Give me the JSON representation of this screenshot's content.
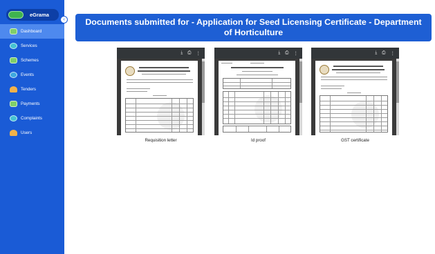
{
  "sidebar": {
    "brand": "eGrama",
    "collapse_icon": "chevron-left-icon",
    "items": [
      {
        "label": "Dashboard",
        "icon": "dashboard-icon",
        "active": true
      },
      {
        "label": "Services",
        "icon": "services-icon",
        "active": false
      },
      {
        "label": "Schemes",
        "icon": "schemes-icon",
        "active": false
      },
      {
        "label": "Events",
        "icon": "events-icon",
        "active": false
      },
      {
        "label": "Tenders",
        "icon": "tenders-icon",
        "active": false
      },
      {
        "label": "Payments",
        "icon": "payments-icon",
        "active": false
      },
      {
        "label": "Complaints",
        "icon": "complaints-icon",
        "active": false
      },
      {
        "label": "Users",
        "icon": "users-icon",
        "active": false
      }
    ]
  },
  "header": {
    "title": "Documents submitted for - Application for Seed Licensing Certificate - Department of Horticulture"
  },
  "documents": [
    {
      "caption": "Requisition letter"
    },
    {
      "caption": "Id proof"
    },
    {
      "caption": "GST certificate"
    }
  ],
  "viewer_toolbar": {
    "download_icon": "download-icon",
    "print_icon": "print-icon",
    "more_icon": "more-vertical-icon"
  },
  "colors": {
    "sidebar": "#1a5bd6",
    "active_item": "#4e89ee",
    "banner": "#1e5fd4"
  }
}
